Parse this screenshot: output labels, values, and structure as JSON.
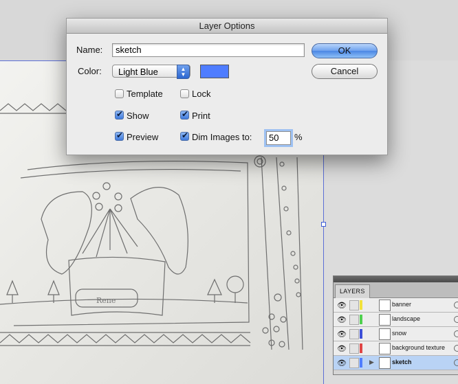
{
  "dialog": {
    "title": "Layer Options",
    "name_label": "Name:",
    "name_value": "sketch",
    "color_label": "Color:",
    "color_selected": "Light Blue",
    "color_swatch": "#4f7dff",
    "checkboxes": {
      "template": {
        "label": "Template",
        "checked": false
      },
      "lock": {
        "label": "Lock",
        "checked": false
      },
      "show": {
        "label": "Show",
        "checked": true
      },
      "print": {
        "label": "Print",
        "checked": true
      },
      "preview": {
        "label": "Preview",
        "checked": true
      },
      "dim": {
        "label": "Dim Images to:",
        "checked": true
      }
    },
    "dim_value": "50",
    "dim_unit": "%",
    "ok_label": "OK",
    "cancel_label": "Cancel"
  },
  "layers_panel": {
    "tab_label": "LAYERS",
    "layers": [
      {
        "name": "banner",
        "color": "#f2e23a",
        "selected": false
      },
      {
        "name": "landscape",
        "color": "#4fd04f",
        "selected": false
      },
      {
        "name": "snow",
        "color": "#3d4fd8",
        "selected": false
      },
      {
        "name": "background texture",
        "color": "#e04545",
        "selected": false
      },
      {
        "name": "sketch",
        "color": "#4f7dff",
        "selected": true
      }
    ]
  }
}
